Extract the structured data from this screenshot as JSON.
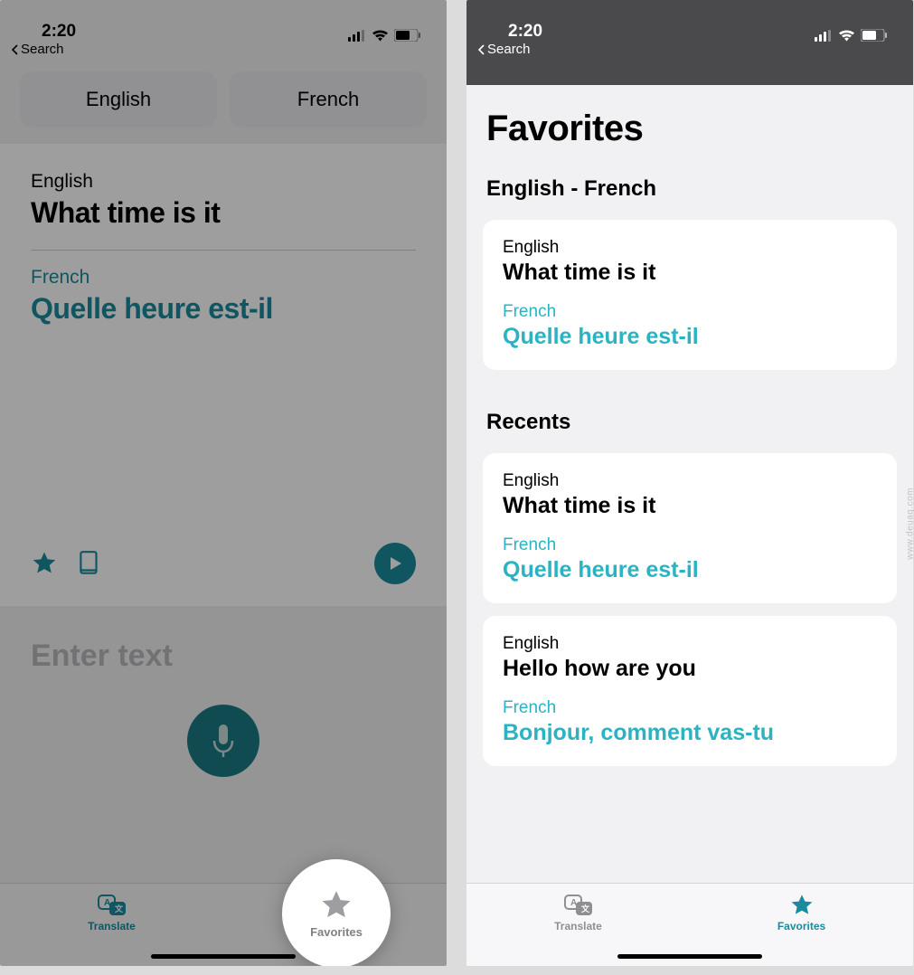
{
  "status": {
    "time": "2:20",
    "back_label": "Search"
  },
  "left": {
    "lang_from": "English",
    "lang_to": "French",
    "source_label": "English",
    "source_text": "What time is it",
    "target_label": "French",
    "target_text": "Quelle heure est-il",
    "input_placeholder": "Enter text"
  },
  "tabs": {
    "translate": "Translate",
    "favorites": "Favorites"
  },
  "right": {
    "title": "Favorites",
    "pair_heading": "English - French",
    "recents_heading": "Recents",
    "favorites": [
      {
        "src_label": "English",
        "src_text": "What time is it",
        "dst_label": "French",
        "dst_text": "Quelle heure est-il"
      }
    ],
    "recents": [
      {
        "src_label": "English",
        "src_text": "What time is it",
        "dst_label": "French",
        "dst_text": "Quelle heure est-il"
      },
      {
        "src_label": "English",
        "src_text": "Hello how are you",
        "dst_label": "French",
        "dst_text": "Bonjour, comment vas-tu"
      }
    ]
  },
  "watermark": "www.deuaq.com"
}
